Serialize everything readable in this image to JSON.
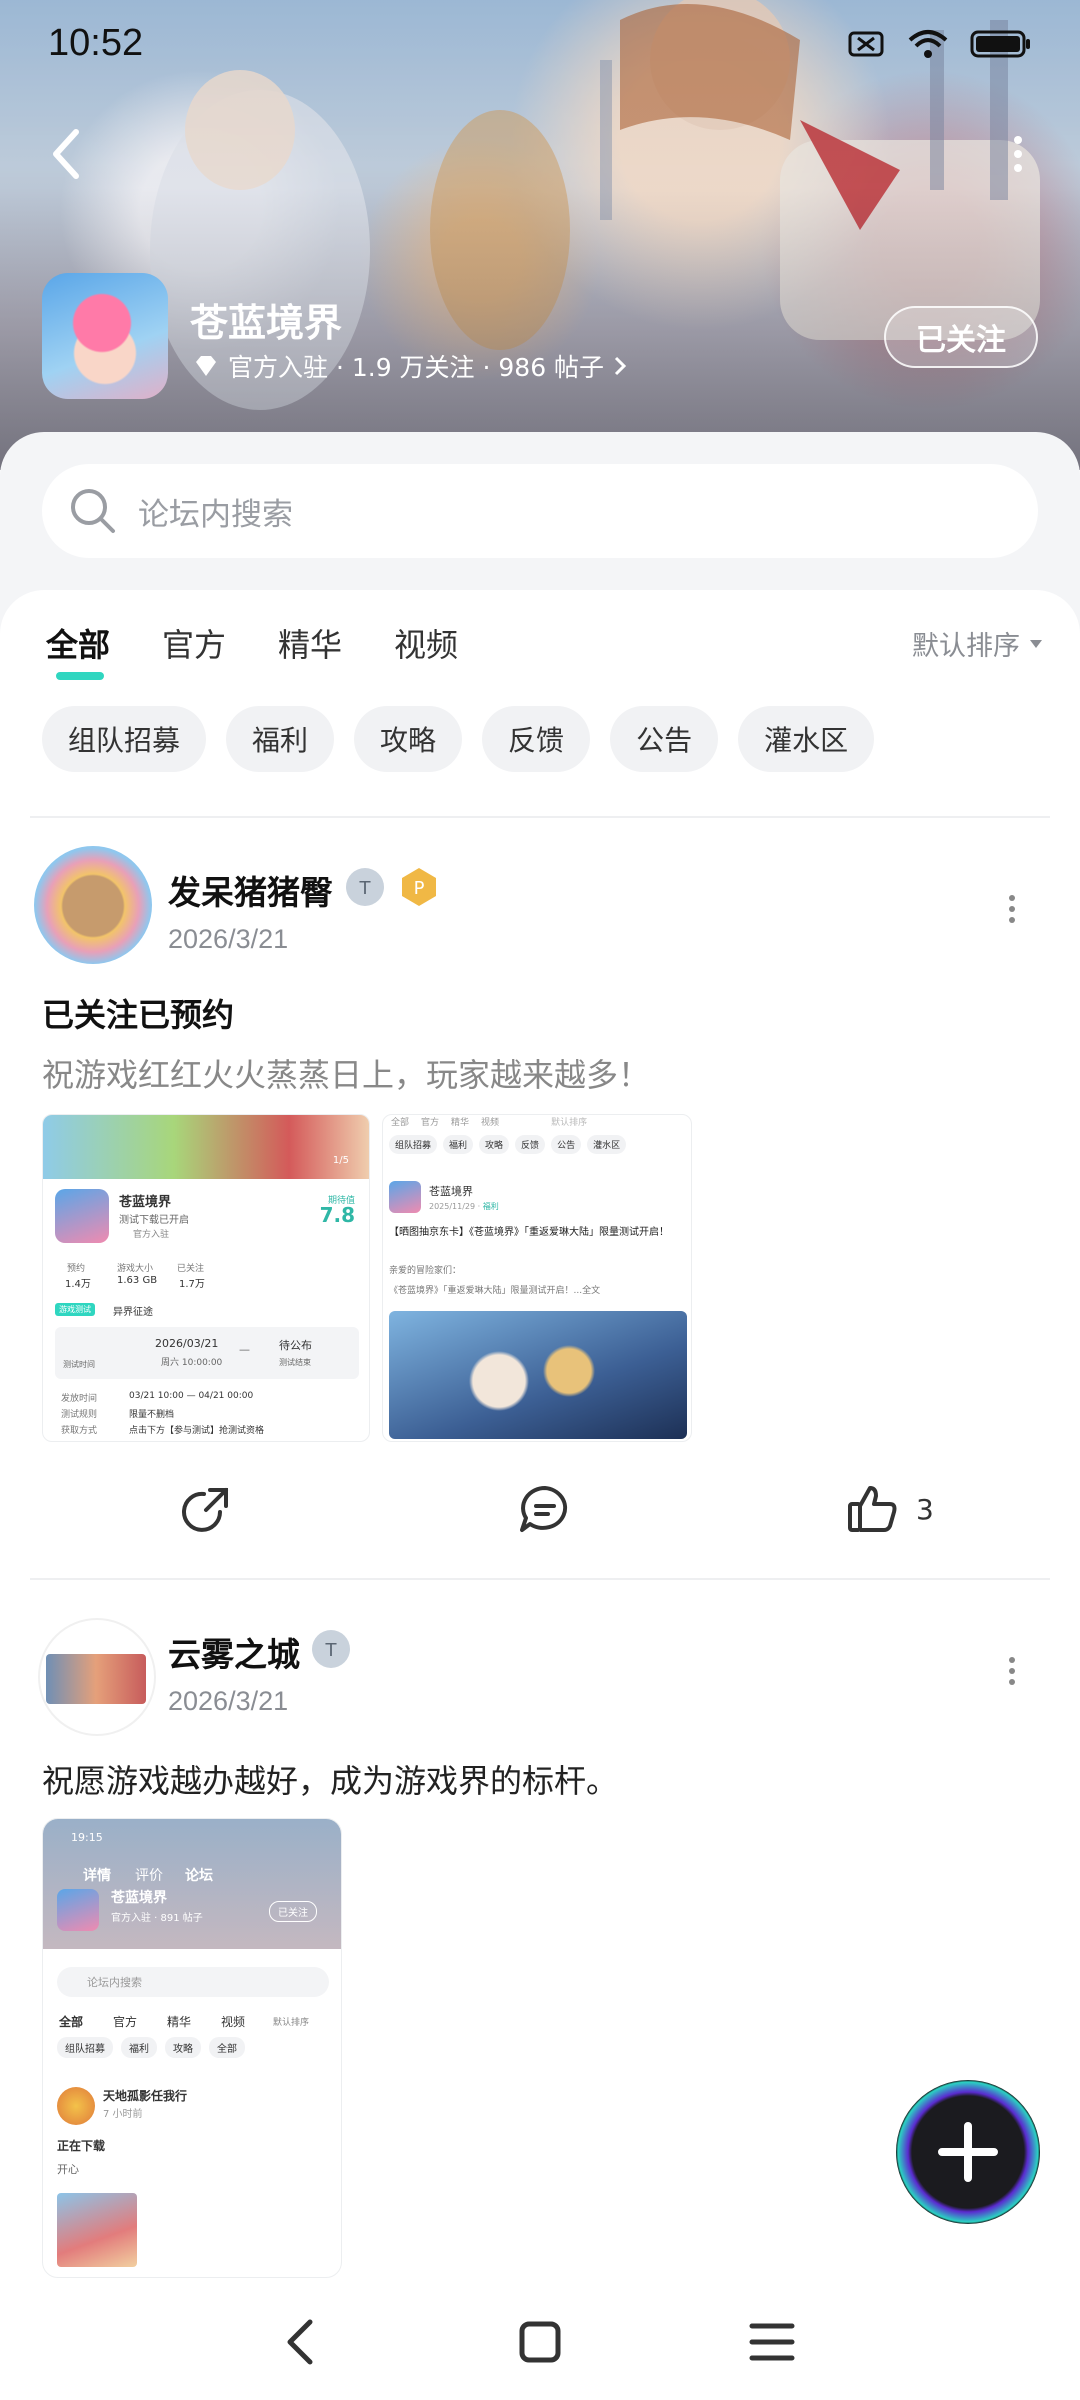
{
  "status_bar": {
    "time": "10:52"
  },
  "header": {
    "app_name": "苍蓝境界",
    "meta": "官方入驻 · 1.9 万关注 · 986 帖子",
    "follow_label": "已关注"
  },
  "search": {
    "placeholder": "论坛内搜索"
  },
  "tabs": [
    {
      "label": "全部",
      "active": true
    },
    {
      "label": "官方"
    },
    {
      "label": "精华"
    },
    {
      "label": "视频"
    }
  ],
  "sort_label": "默认排序",
  "chips": [
    "组队招募",
    "福利",
    "攻略",
    "反馈",
    "公告",
    "灌水区"
  ],
  "posts": [
    {
      "username": "发呆猪猪臀",
      "date": "2026/3/21",
      "title": "已关注已预约",
      "body": "祝游戏红红火火蒸蒸日上，玩家越来越多！",
      "likes": "3",
      "thumb1": {
        "counter": "1/5",
        "app": "苍蓝境界",
        "sub": "测试下载已开启",
        "official": "官方入驻",
        "score_label": "期待值",
        "score": "7.8",
        "stats": [
          {
            "label": "预约",
            "value": "1.4万"
          },
          {
            "label": "游戏大小",
            "value": "1.63 GB"
          },
          {
            "label": "已关注",
            "value": "1.7万"
          }
        ],
        "test_tag": "游戏测试",
        "test_name": "异界征途",
        "test_time_label": "测试时间",
        "date": "2026/03/21",
        "weekday": "周六 10:00:00",
        "dash": "—",
        "end": "待公布",
        "end_label": "测试结束",
        "rows": [
          {
            "k": "发放时间",
            "v": "03/21 10:00 — 04/21 00:00"
          },
          {
            "k": "测试规则",
            "v": "限量不删档"
          },
          {
            "k": "获取方式",
            "v": "点击下方【参与测试】抢测试资格"
          }
        ]
      },
      "thumb2": {
        "top_tabs": [
          "全部",
          "官方",
          "精华",
          "视频",
          "默认排序"
        ],
        "chips": [
          "组队招募",
          "福利",
          "攻略",
          "反馈",
          "公告",
          "灌水区"
        ],
        "app": "苍蓝境界",
        "meta": "2025/11/29 · ",
        "meta_tag": "福利",
        "title": "【晒图抽京东卡】《苍蓝境界》「重返爱琳大陆」限量测试开启！",
        "greet": "亲爱的冒险家们：",
        "line": "《苍蓝境界》「重返爱琳大陆」限量测试开启！...全文"
      }
    },
    {
      "username": "云雾之城",
      "date": "2026/3/21",
      "body": "祝愿游戏越办越好，成为游戏界的标杆。",
      "thumb": {
        "time": "19:15",
        "tabs": [
          "详情",
          "评价",
          "论坛"
        ],
        "app": "苍蓝境界",
        "meta": "官方入驻 · 891 帖子",
        "follow": "已关注",
        "search": "论坛内搜索",
        "tabs2": [
          "全部",
          "官方",
          "精华",
          "视频",
          "默认排序"
        ],
        "chips": [
          "组队招募",
          "福利",
          "攻略",
          "全部"
        ],
        "user": "天地孤影任我行",
        "time_ago": "7 小时前",
        "title": "正在下载",
        "body": "开心"
      }
    }
  ],
  "colors": {
    "accent": "#2fd6c0",
    "purple": "#5a2bd0"
  }
}
